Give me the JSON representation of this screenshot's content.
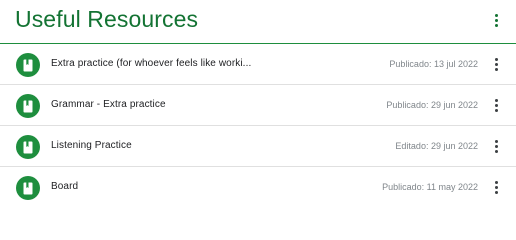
{
  "header": {
    "title": "Useful Resources",
    "menu_icon": "more-vert-icon"
  },
  "items": [
    {
      "label": "Extra practice (for whoever feels like worki...",
      "date": "Publicado: 13 jul 2022",
      "icon": "material-icon"
    },
    {
      "label": "Grammar - Extra practice",
      "date": "Publicado: 29 jun 2022",
      "icon": "material-icon"
    },
    {
      "label": "Listening Practice",
      "date": "Editado: 29 jun 2022",
      "icon": "material-icon"
    },
    {
      "label": "Board",
      "date": "Publicado: 11 may 2022",
      "icon": "material-icon"
    }
  ],
  "colors": {
    "accent": "#137333",
    "icon_bg": "#1e8e3e",
    "divider": "#e0e0e0",
    "date_text": "#80868b"
  }
}
